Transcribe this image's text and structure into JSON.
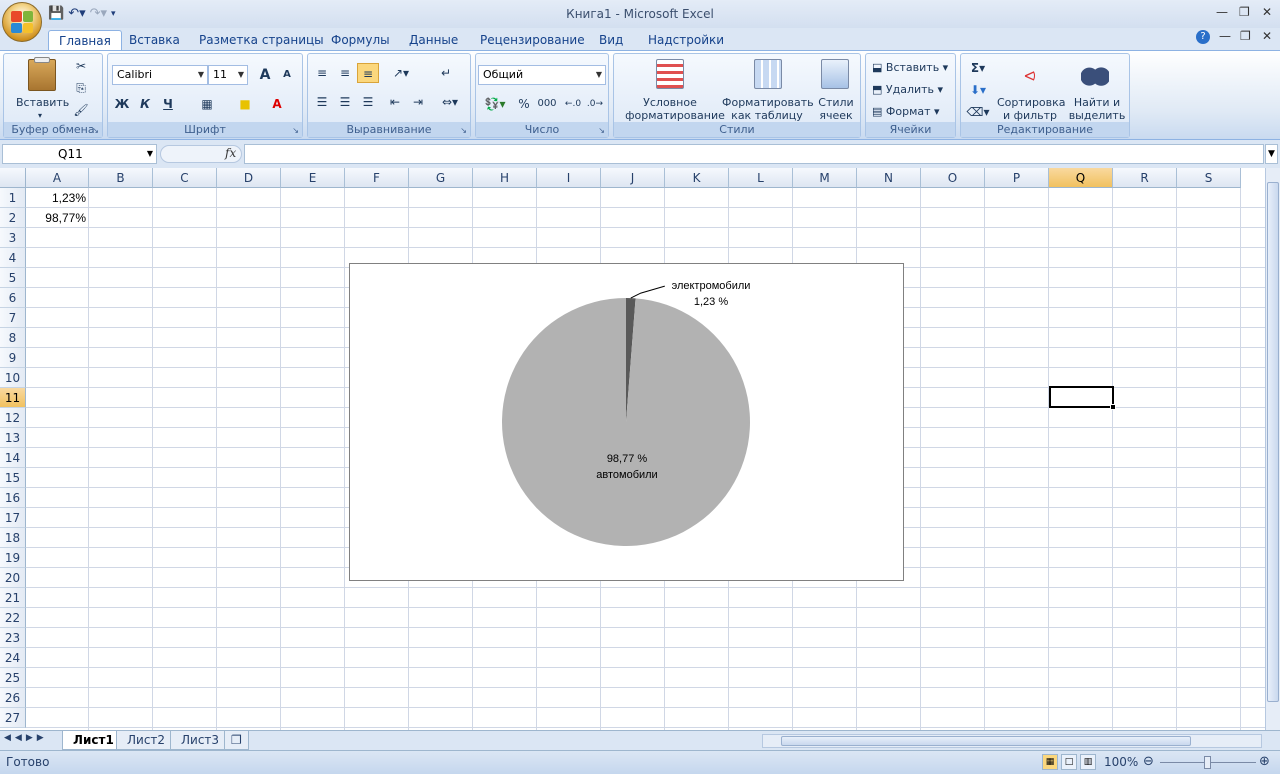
{
  "window": {
    "title": "Книга1 - Microsoft Excel"
  },
  "quick_access": {
    "save_icon": "save-icon",
    "undo_icon": "undo-icon",
    "redo_icon": "redo-icon"
  },
  "tabs": [
    "Главная",
    "Вставка",
    "Разметка страницы",
    "Формулы",
    "Данные",
    "Рецензирование",
    "Вид",
    "Надстройки"
  ],
  "ribbon": {
    "clipboard": {
      "paste_label": "Вставить",
      "caption": "Буфер обмена"
    },
    "font": {
      "name": "Calibri",
      "size": "11",
      "caption": "Шрифт",
      "bold": "Ж",
      "italic": "К",
      "underline": "Ч",
      "grow": "A",
      "shrink": "A"
    },
    "alignment": {
      "caption": "Выравнивание"
    },
    "number": {
      "format": "Общий",
      "percent": "%",
      "thousands": "000",
      "caption": "Число"
    },
    "styles": {
      "conditional_line1": "Условное",
      "conditional_line2": "форматирование",
      "table_line1": "Форматировать",
      "table_line2": "как таблицу",
      "cell_line1": "Стили",
      "cell_line2": "ячеек",
      "caption": "Стили"
    },
    "cells": {
      "insert": "Вставить",
      "delete": "Удалить",
      "format": "Формат",
      "caption": "Ячейки"
    },
    "editing": {
      "sigma": "Σ",
      "sort_line1": "Сортировка",
      "sort_line2": "и фильтр",
      "find_line1": "Найти и",
      "find_line2": "выделить",
      "caption": "Редактирование"
    }
  },
  "formula_bar": {
    "name_box": "Q11",
    "fx": "fx",
    "value": ""
  },
  "columns": [
    "A",
    "B",
    "C",
    "D",
    "E",
    "F",
    "G",
    "H",
    "I",
    "J",
    "K",
    "L",
    "M",
    "N",
    "O",
    "P",
    "Q",
    "R",
    "S"
  ],
  "rows": [
    "1",
    "2",
    "3",
    "4",
    "5",
    "6",
    "7",
    "8",
    "9",
    "10",
    "11",
    "12",
    "13",
    "14",
    "15",
    "16",
    "17",
    "18",
    "19",
    "20",
    "21",
    "22",
    "23",
    "24",
    "25",
    "26",
    "27"
  ],
  "cells": {
    "A1": "1,23%",
    "A2": "98,77%"
  },
  "chart_data": {
    "type": "pie",
    "categories": [
      "электромобили",
      "автомобили"
    ],
    "values": [
      1.23,
      98.77
    ],
    "data_labels": [
      "1,23 %",
      "98,77 %"
    ],
    "colors": [
      "#595959",
      "#b2b2b2"
    ]
  },
  "sheets": [
    "Лист1",
    "Лист2",
    "Лист3"
  ],
  "status": {
    "text": "Готово",
    "zoom": "100%"
  }
}
